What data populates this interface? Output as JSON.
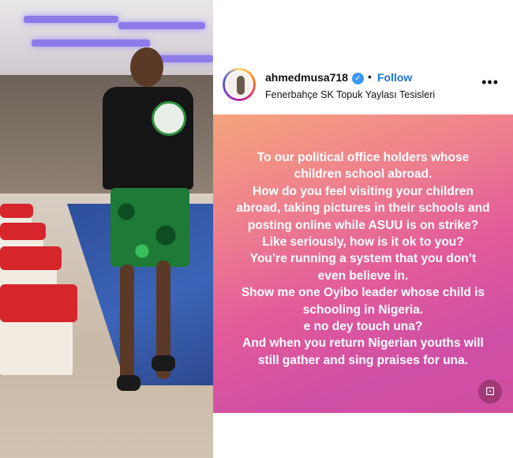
{
  "post": {
    "username": "ahmedmusa718",
    "follow_label": "Follow",
    "separator": "•",
    "location": "Fenerbahçe SK Topuk Yaylası Tesisleri",
    "more_icon": "more-horizontal-icon",
    "verified_icon": "verified-badge-icon",
    "story_lines": [
      "To our political office holders whose",
      "children school abroad.",
      "How do you feel visiting your children",
      "abroad, taking pictures in their schools and",
      "posting online while ASUU is on strike?",
      "Like seriously, how is it ok to you?",
      "You’re running a system that you don’t",
      "even believe in.",
      "Show me one Oyibo leader whose child is",
      "schooling in Nigeria.",
      "e no dey touch una?",
      "And when you return Nigerian youths will",
      "still gather and sing praises for una."
    ],
    "scan_icon": "text-scan-icon"
  },
  "colors": {
    "follow": "#1d73d6",
    "verified": "#3897f0",
    "story_gradient_start": "#f6a37c",
    "story_gradient_end": "#d14ea0"
  }
}
